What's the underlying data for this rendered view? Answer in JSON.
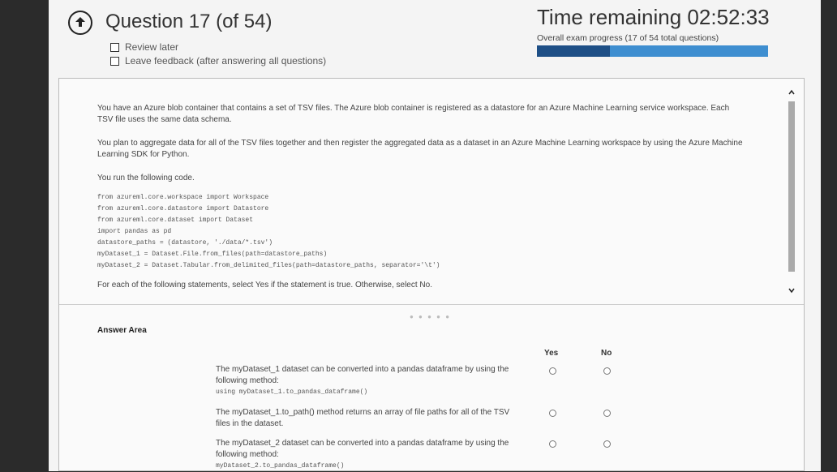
{
  "header": {
    "question_title": "Question 17 (of 54)",
    "review_later": "Review later",
    "leave_feedback": "Leave feedback (after answering all questions)",
    "time_label": "Time remaining 02:52:33",
    "progress_text": "Overall exam progress (17 of 54 total questions)",
    "progress_fraction": 0.315
  },
  "question": {
    "para1": "You have an Azure blob container that contains a set of TSV files. The Azure blob container is registered as a datastore for an Azure Machine Learning service workspace. Each TSV file uses the same data schema.",
    "para2": "You plan to aggregate data for all of the TSV files together and then register the aggregated data as a dataset in an Azure Machine Learning workspace by using the Azure Machine Learning SDK for Python.",
    "para3": "You run the following code.",
    "code": [
      "from azureml.core.workspace import Workspace",
      "from azureml.core.datastore import Datastore",
      "from azureml.core.dataset import Dataset",
      "import pandas as pd",
      "datastore_paths = (datastore, './data/*.tsv')",
      "myDataset_1 = Dataset.File.from_files(path=datastore_paths)",
      "myDataset_2 = Dataset.Tabular.from_delimited_files(path=datastore_paths, separator='\\t')"
    ],
    "instruction": "For each of the following statements, select Yes if the statement is true. Otherwise, select No."
  },
  "answer_area": {
    "title": "Answer Area",
    "col_yes": "Yes",
    "col_no": "No",
    "statements": [
      {
        "text": "The myDataset_1 dataset can be converted into a pandas dataframe by using the following method:",
        "code": "using myDataset_1.to_pandas_dataframe()"
      },
      {
        "text": "The myDataset_1.to_path() method returns an array of file paths for all of the TSV files in the dataset.",
        "code": ""
      },
      {
        "text": "The myDataset_2 dataset can be converted into a pandas dataframe by using the following method:",
        "code": "myDataset_2.to_pandas_dataframe()"
      }
    ]
  },
  "icons": {
    "back": "back-arrow-icon",
    "scroll_up": "chevron-up-icon",
    "scroll_down": "chevron-down-icon"
  },
  "colors": {
    "progress_fill": "#1e4f86",
    "progress_track": "#3e8ed0"
  }
}
